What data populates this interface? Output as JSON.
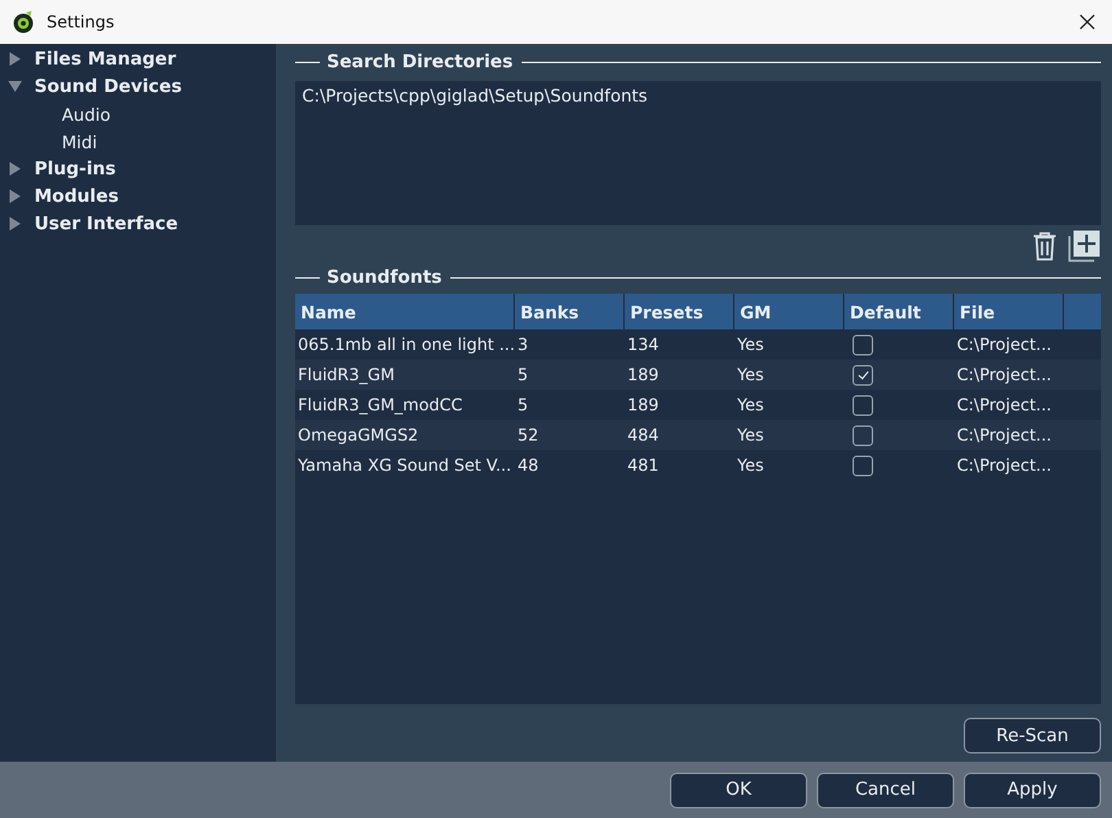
{
  "window": {
    "title": "Settings"
  },
  "sidebar": {
    "items": [
      {
        "label": "Files Manager",
        "expanded": false
      },
      {
        "label": "Sound Devices",
        "expanded": true,
        "children": [
          {
            "label": "Audio"
          },
          {
            "label": "Midi"
          }
        ]
      },
      {
        "label": "Plug-ins",
        "expanded": false
      },
      {
        "label": "Modules",
        "expanded": false
      },
      {
        "label": "User Interface",
        "expanded": false
      }
    ]
  },
  "search_directories": {
    "title": "Search Directories",
    "entries": [
      "C:\\Projects\\cpp\\giglad\\Setup\\Soundfonts"
    ]
  },
  "soundfonts": {
    "title": "Soundfonts",
    "columns": [
      "Name",
      "Banks",
      "Presets",
      "GM",
      "Default",
      "File"
    ],
    "rows": [
      {
        "name": "065.1mb all in one light ...",
        "banks": "3",
        "presets": "134",
        "gm": "Yes",
        "default": false,
        "file": "C:\\Project..."
      },
      {
        "name": "FluidR3_GM",
        "banks": "5",
        "presets": "189",
        "gm": "Yes",
        "default": true,
        "file": "C:\\Project..."
      },
      {
        "name": "FluidR3_GM_modCC",
        "banks": "5",
        "presets": "189",
        "gm": "Yes",
        "default": false,
        "file": "C:\\Project..."
      },
      {
        "name": "OmegaGMGS2",
        "banks": "52",
        "presets": "484",
        "gm": "Yes",
        "default": false,
        "file": "C:\\Project..."
      },
      {
        "name": "Yamaha XG Sound Set V...",
        "banks": "48",
        "presets": "481",
        "gm": "Yes",
        "default": false,
        "file": "C:\\Project..."
      }
    ]
  },
  "rescan_button": "Re-Scan",
  "buttons": [
    "OK",
    "Cancel",
    "Apply"
  ]
}
